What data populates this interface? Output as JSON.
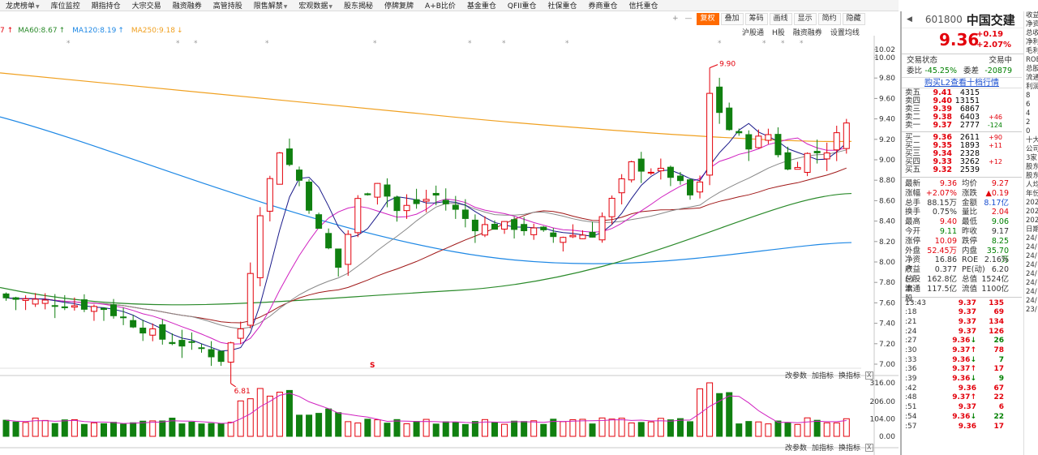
{
  "topbar": [
    "龙虎榜单",
    "库位监控",
    "期指持仓",
    "大宗交易",
    "融资融券",
    "高管持股",
    "限售解禁",
    "宏观数据",
    "股东揭秘",
    "停牌复牌",
    "A+B比价",
    "基金重仓",
    "QFII重仓",
    "社保重仓",
    "券商重仓",
    "信托重仓"
  ],
  "topbar_dropdowns": [
    0,
    6,
    7
  ],
  "chart_tools": {
    "plus": "+",
    "minus": "—",
    "fuquan": "复权",
    "overlay": "叠加",
    "chip": "筹码",
    "draw": "画线",
    "display": "显示",
    "simple": "简约",
    "hide": "隐藏"
  },
  "ma_legend": [
    {
      "label": "MA60:8.67",
      "arrow": "↑",
      "color": "#2a8a2a"
    },
    {
      "label": "MA120:8.19",
      "arrow": "↑",
      "color": "#1e88e5"
    },
    {
      "label": "MA250:9.18",
      "arrow": "↓",
      "color": "#f0a020"
    }
  ],
  "subtools": [
    "沪股通",
    "H股",
    "融资融券",
    "设置均线"
  ],
  "annotations": {
    "high": "9.90",
    "low": "6.81",
    "s_mark": "S"
  },
  "vol_tools": {
    "params": "改参数",
    "add": "加指标",
    "switch": "换指标",
    "close": "X"
  },
  "price_axis": [
    "10.02",
    "10.00",
    "9.80",
    "9.60",
    "9.40",
    "9.20",
    "9.00",
    "8.80",
    "8.60",
    "8.40",
    "8.20",
    "8.00",
    "7.80",
    "7.60",
    "7.40",
    "7.20",
    "7.00"
  ],
  "vol_axis": [
    "316.00",
    "206.00",
    "104.00",
    "0.00"
  ],
  "chart_data": {
    "type": "candlestick",
    "ylim": [
      6.7,
      10.02
    ],
    "ma_lines": [
      {
        "name": "MA60",
        "value": 8.67,
        "color": "#2a8a2a"
      },
      {
        "name": "MA120",
        "value": 8.19,
        "color": "#1e88e5"
      },
      {
        "name": "MA250",
        "value": 9.18,
        "color": "#f0a020"
      }
    ],
    "high_marker": 9.9,
    "low_marker": 6.81,
    "volume_ylim": [
      0,
      316
    ],
    "last_volume": 104
  },
  "panel": {
    "code": "601800",
    "name": "中国交建",
    "price": "9.36",
    "change": "+0.19",
    "change_pct": "+2.07%",
    "status_label": "交易状态",
    "status_value": "交易中",
    "weibi_label": "委比",
    "weibi_value": "-45.25%",
    "weicha_label": "委差",
    "weicha_value": "-20879",
    "l2_link": "购买L2查看十档行情",
    "asks": [
      {
        "label": "卖五",
        "price": "9.41",
        "vol": "4315",
        "delta": ""
      },
      {
        "label": "卖四",
        "price": "9.40",
        "vol": "13151",
        "delta": ""
      },
      {
        "label": "卖三",
        "price": "9.39",
        "vol": "6867",
        "delta": ""
      },
      {
        "label": "卖二",
        "price": "9.38",
        "vol": "6403",
        "delta": "+46"
      },
      {
        "label": "卖一",
        "price": "9.37",
        "vol": "2777",
        "delta": "-124"
      }
    ],
    "bids": [
      {
        "label": "买一",
        "price": "9.36",
        "vol": "2611",
        "delta": "+90"
      },
      {
        "label": "买二",
        "price": "9.35",
        "vol": "1893",
        "delta": "+11"
      },
      {
        "label": "买三",
        "price": "9.34",
        "vol": "2328",
        "delta": ""
      },
      {
        "label": "买四",
        "price": "9.33",
        "vol": "3262",
        "delta": "+12"
      },
      {
        "label": "买五",
        "price": "9.32",
        "vol": "2539",
        "delta": ""
      }
    ],
    "quote": [
      [
        "最新",
        "9.36",
        "red",
        "均价",
        "9.27",
        "red"
      ],
      [
        "涨幅",
        "+2.07%",
        "red",
        "涨跌",
        "▲0.19",
        "red"
      ],
      [
        "总手",
        "88.15万",
        "",
        "金额",
        "8.17亿",
        "blue"
      ],
      [
        "换手",
        "0.75%",
        "",
        "量比",
        "2.04",
        "red"
      ],
      [
        "最高",
        "9.40",
        "red",
        "最低",
        "9.06",
        "green"
      ],
      [
        "今开",
        "9.11",
        "green",
        "昨收",
        "9.17",
        ""
      ],
      [
        "涨停",
        "10.09",
        "red",
        "跌停",
        "8.25",
        "green"
      ],
      [
        "外盘",
        "52.45万",
        "red",
        "内盘",
        "35.70万",
        "green"
      ],
      [
        "净资产",
        "16.86",
        "",
        "ROE",
        "2.16%",
        ""
      ],
      [
        "收益(-)",
        "0.377",
        "",
        "PE(动)",
        "6.20",
        ""
      ],
      [
        "总股本",
        "162.8亿",
        "",
        "总值",
        "1524亿",
        ""
      ],
      [
        "流通股",
        "117.5亿",
        "",
        "流值",
        "1100亿",
        ""
      ]
    ],
    "ticks": [
      [
        "13:43",
        "9.37",
        "",
        "135"
      ],
      [
        ":18",
        "9.37",
        "",
        "69"
      ],
      [
        ":21",
        "9.37",
        "",
        "134"
      ],
      [
        ":24",
        "9.37",
        "",
        "126"
      ],
      [
        ":27",
        "9.36",
        "↓",
        "26"
      ],
      [
        ":30",
        "9.37",
        "↑",
        "78"
      ],
      [
        ":33",
        "9.36",
        "↓",
        "7"
      ],
      [
        ":36",
        "9.37",
        "↑",
        "17"
      ],
      [
        ":39",
        "9.36",
        "↓",
        "9"
      ],
      [
        ":42",
        "9.36",
        "",
        "67"
      ],
      [
        ":48",
        "9.37",
        "↑",
        "22"
      ],
      [
        ":51",
        "9.37",
        "",
        "6"
      ],
      [
        ":54",
        "9.36",
        "↓",
        "22"
      ],
      [
        ":57",
        "9.36",
        "",
        "17"
      ]
    ],
    "stripe": [
      "收益",
      "净资",
      "总收",
      "净利",
      "毛利",
      "ROE",
      "总股",
      "流通",
      "利润",
      "8",
      "6",
      "4",
      "2",
      "0",
      "十大",
      "公司",
      "3家",
      "股东",
      "股东",
      "人均",
      "年份",
      "202",
      "202",
      "202",
      "日期",
      "24/",
      "24/",
      "24/",
      "24/",
      "24/",
      "24/",
      "24/",
      "24/",
      "23/"
    ]
  }
}
